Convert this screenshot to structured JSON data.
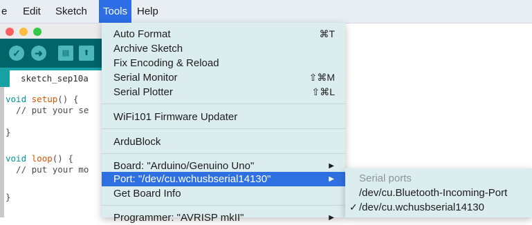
{
  "menubar": {
    "items": [
      {
        "label": "e"
      },
      {
        "label": "Edit"
      },
      {
        "label": "Sketch"
      },
      {
        "label": "Tools"
      },
      {
        "label": "Help"
      }
    ]
  },
  "window": {
    "tab_label": "sketch_sep10a",
    "toolbar_icons": [
      "verify-icon",
      "upload-icon",
      "new-icon",
      "open-icon"
    ],
    "code": {
      "line1_kw": "void",
      "line1_fn": "setup",
      "line1_rest": "() {",
      "line2": "  // put your se",
      "line3": "",
      "line4": "}",
      "line5": "",
      "line6_kw": "void",
      "line6_fn": "loop",
      "line6_rest": "() {",
      "line7": "  // put your mo",
      "line8": "",
      "line9": "}"
    }
  },
  "tools_menu": {
    "items": [
      {
        "label": "Auto Format",
        "shortcut": "⌘T"
      },
      {
        "label": "Archive Sketch",
        "shortcut": ""
      },
      {
        "label": "Fix Encoding & Reload",
        "shortcut": ""
      },
      {
        "label": "Serial Monitor",
        "shortcut": "⇧⌘M"
      },
      {
        "label": "Serial Plotter",
        "shortcut": "⇧⌘L"
      },
      {
        "label": "WiFi101 Firmware Updater",
        "shortcut": ""
      },
      {
        "label": "ArduBlock",
        "shortcut": ""
      },
      {
        "label": "Board: \"Arduino/Genuino Uno\"",
        "submenu_arrow": "▶"
      },
      {
        "label": "Port: \"/dev/cu.wchusbserial14130\"",
        "submenu_arrow": "▶"
      },
      {
        "label": "Get Board Info"
      },
      {
        "label": "Programmer: \"AVRISP mkII\"",
        "submenu_arrow": "▶"
      }
    ]
  },
  "port_submenu": {
    "header": "Serial ports",
    "items": [
      {
        "label": "/dev/cu.Bluetooth-Incoming-Port",
        "checked": ""
      },
      {
        "label": "/dev/cu.wchusbserial14130",
        "checked": "✓"
      }
    ]
  },
  "colors": {
    "menu_highlight": "#2f70e0",
    "toolbar": "#006468",
    "tabbar": "#17a1a5"
  }
}
